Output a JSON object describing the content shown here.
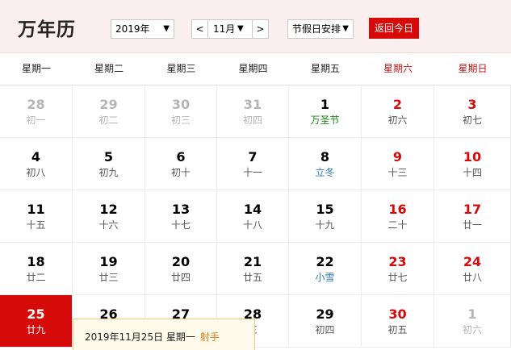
{
  "app": {
    "title": "万年历"
  },
  "controls": {
    "year": "2019年",
    "prev_month": "<",
    "month": "11月",
    "next_month": ">",
    "holiday_mode": "节假日安排",
    "today_button": "返回今日",
    "arrow": "▼"
  },
  "weekdays": [
    "星期一",
    "星期二",
    "星期三",
    "星期四",
    "星期五",
    "星期六",
    "星期日"
  ],
  "weeks": [
    [
      {
        "day": "28",
        "lunar": "初一",
        "type": "other"
      },
      {
        "day": "29",
        "lunar": "初二",
        "type": "other"
      },
      {
        "day": "30",
        "lunar": "初三",
        "type": "other"
      },
      {
        "day": "31",
        "lunar": "初四",
        "type": "other"
      },
      {
        "day": "1",
        "lunar": "万圣节",
        "type": "festival"
      },
      {
        "day": "2",
        "lunar": "初六",
        "type": "weekend"
      },
      {
        "day": "3",
        "lunar": "初七",
        "type": "weekend"
      }
    ],
    [
      {
        "day": "4",
        "lunar": "初八",
        "type": "normal"
      },
      {
        "day": "5",
        "lunar": "初九",
        "type": "normal"
      },
      {
        "day": "6",
        "lunar": "初十",
        "type": "normal"
      },
      {
        "day": "7",
        "lunar": "十一",
        "type": "normal"
      },
      {
        "day": "8",
        "lunar": "立冬",
        "type": "term"
      },
      {
        "day": "9",
        "lunar": "十三",
        "type": "weekend"
      },
      {
        "day": "10",
        "lunar": "十四",
        "type": "weekend"
      }
    ],
    [
      {
        "day": "11",
        "lunar": "十五",
        "type": "normal"
      },
      {
        "day": "12",
        "lunar": "十六",
        "type": "normal"
      },
      {
        "day": "13",
        "lunar": "十七",
        "type": "normal"
      },
      {
        "day": "14",
        "lunar": "十八",
        "type": "normal"
      },
      {
        "day": "15",
        "lunar": "十九",
        "type": "normal"
      },
      {
        "day": "16",
        "lunar": "二十",
        "type": "weekend"
      },
      {
        "day": "17",
        "lunar": "廿一",
        "type": "weekend"
      }
    ],
    [
      {
        "day": "18",
        "lunar": "廿二",
        "type": "normal"
      },
      {
        "day": "19",
        "lunar": "廿三",
        "type": "normal"
      },
      {
        "day": "20",
        "lunar": "廿四",
        "type": "normal"
      },
      {
        "day": "21",
        "lunar": "廿五",
        "type": "normal"
      },
      {
        "day": "22",
        "lunar": "小雪",
        "type": "term"
      },
      {
        "day": "23",
        "lunar": "廿七",
        "type": "weekend"
      },
      {
        "day": "24",
        "lunar": "廿八",
        "type": "weekend"
      }
    ],
    [
      {
        "day": "25",
        "lunar": "廿九",
        "type": "today"
      },
      {
        "day": "26",
        "lunar": "",
        "type": "normal"
      },
      {
        "day": "27",
        "lunar": "",
        "type": "normal"
      },
      {
        "day": "28",
        "lunar": "三",
        "type": "normal"
      },
      {
        "day": "29",
        "lunar": "初四",
        "type": "normal"
      },
      {
        "day": "30",
        "lunar": "初五",
        "type": "weekend"
      },
      {
        "day": "1",
        "lunar": "初六",
        "type": "other"
      }
    ]
  ],
  "tooltip": {
    "date": "2019年11月25日 星期一",
    "astro": "射手"
  },
  "colors": {
    "accent": "#d70a0a",
    "header_bg": "#fbeeee",
    "festival": "#1a8a1a",
    "term": "#2e7bb7",
    "muted": "#b5b5b5"
  }
}
